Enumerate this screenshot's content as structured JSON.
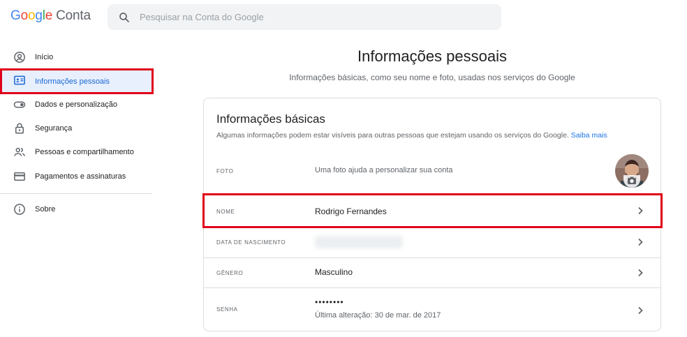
{
  "header": {
    "logo_letters": [
      "G",
      "o",
      "o",
      "g",
      "l",
      "e"
    ],
    "product": "Conta",
    "search_placeholder": "Pesquisar na Conta do Google"
  },
  "sidebar": {
    "items": [
      {
        "label": "Início",
        "icon": "account-circle-icon"
      },
      {
        "label": "Informações pessoais",
        "icon": "id-card-icon",
        "active": true
      },
      {
        "label": "Dados e personalização",
        "icon": "toggle-icon"
      },
      {
        "label": "Segurança",
        "icon": "lock-icon"
      },
      {
        "label": "Pessoas e compartilhamento",
        "icon": "people-icon"
      },
      {
        "label": "Pagamentos e assinaturas",
        "icon": "credit-card-icon"
      },
      {
        "label": "Sobre",
        "icon": "info-icon"
      }
    ]
  },
  "main": {
    "title": "Informações pessoais",
    "subtitle": "Informações básicas, como seu nome e foto, usadas nos serviços do Google"
  },
  "card": {
    "title": "Informações básicas",
    "description": "Algumas informações podem estar visíveis para outras pessoas que estejam usando os serviços do Google.",
    "learn_more": "Saiba mais",
    "rows": {
      "foto": {
        "label": "FOTO",
        "value": "Uma foto ajuda a personalizar sua conta"
      },
      "nome": {
        "label": "NOME",
        "value": "Rodrigo Fernandes"
      },
      "nascimento": {
        "label": "DATA DE NASCIMENTO"
      },
      "genero": {
        "label": "GÊNERO",
        "value": "Masculino"
      },
      "senha": {
        "label": "SENHA",
        "value": "••••••••",
        "sub": "Última alteração: 30 de mar. de 2017"
      }
    }
  },
  "colors": {
    "accent": "#1a73e8",
    "active_bg": "#e8f0fe",
    "highlight_border": "#e0001b"
  }
}
